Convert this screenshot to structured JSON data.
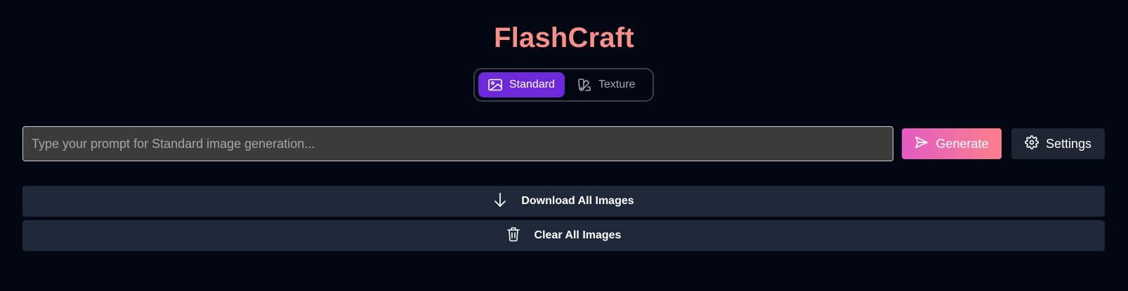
{
  "app": {
    "title": "FlashCraft"
  },
  "modes": {
    "standard_label": "Standard",
    "texture_label": "Texture",
    "active": "Standard",
    "standard_icon": "image-icon",
    "texture_icon": "swatch-icon"
  },
  "prompt": {
    "placeholder": "Type your prompt for Standard image generation...",
    "value": ""
  },
  "actions": {
    "generate_label": "Generate",
    "generate_icon": "send-icon",
    "settings_label": "Settings",
    "settings_icon": "gear-icon",
    "download_all_label": "Download All Images",
    "download_icon": "arrow-down-icon",
    "clear_all_label": "Clear All Images",
    "clear_icon": "trash-icon"
  },
  "colors": {
    "background": "#030712",
    "title": "#f7908a",
    "mode_active": "#6d28d9",
    "generate_gradient_start": "#e25bc4",
    "generate_gradient_end": "#fb7f8c",
    "secondary_button": "#1e2838"
  }
}
